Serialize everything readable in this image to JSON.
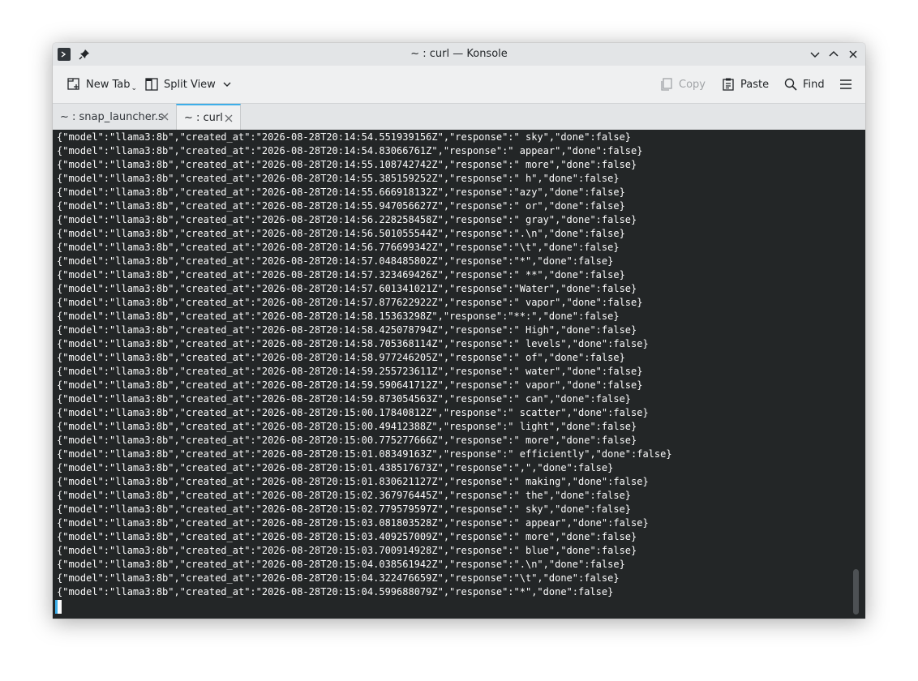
{
  "window": {
    "title": "~ : curl — Konsole"
  },
  "toolbar": {
    "new_tab_label": "New Tab",
    "split_view_label": "Split View",
    "copy_label": "Copy",
    "paste_label": "Paste",
    "find_label": "Find"
  },
  "tabs": [
    {
      "label": "~ : snap_launcher.s",
      "active": false
    },
    {
      "label": "~ : curl",
      "active": true
    }
  ],
  "colors": {
    "terminal_bg": "#232627",
    "terminal_fg": "#fcfcfc",
    "accent": "#3daee9"
  },
  "terminal": {
    "lines": [
      "{\"model\":\"llama3:8b\",\"created_at\":\"2026-08-28T20:14:54.551939156Z\",\"response\":\" sky\",\"done\":false}",
      "{\"model\":\"llama3:8b\",\"created_at\":\"2026-08-28T20:14:54.83066761Z\",\"response\":\" appear\",\"done\":false}",
      "{\"model\":\"llama3:8b\",\"created_at\":\"2026-08-28T20:14:55.108742742Z\",\"response\":\" more\",\"done\":false}",
      "{\"model\":\"llama3:8b\",\"created_at\":\"2026-08-28T20:14:55.385159252Z\",\"response\":\" h\",\"done\":false}",
      "{\"model\":\"llama3:8b\",\"created_at\":\"2026-08-28T20:14:55.666918132Z\",\"response\":\"azy\",\"done\":false}",
      "{\"model\":\"llama3:8b\",\"created_at\":\"2026-08-28T20:14:55.947056627Z\",\"response\":\" or\",\"done\":false}",
      "{\"model\":\"llama3:8b\",\"created_at\":\"2026-08-28T20:14:56.228258458Z\",\"response\":\" gray\",\"done\":false}",
      "{\"model\":\"llama3:8b\",\"created_at\":\"2026-08-28T20:14:56.501055544Z\",\"response\":\".\\n\",\"done\":false}",
      "{\"model\":\"llama3:8b\",\"created_at\":\"2026-08-28T20:14:56.776699342Z\",\"response\":\"\\t\",\"done\":false}",
      "{\"model\":\"llama3:8b\",\"created_at\":\"2026-08-28T20:14:57.048485802Z\",\"response\":\"*\",\"done\":false}",
      "{\"model\":\"llama3:8b\",\"created_at\":\"2026-08-28T20:14:57.323469426Z\",\"response\":\" **\",\"done\":false}",
      "{\"model\":\"llama3:8b\",\"created_at\":\"2026-08-28T20:14:57.601341021Z\",\"response\":\"Water\",\"done\":false}",
      "{\"model\":\"llama3:8b\",\"created_at\":\"2026-08-28T20:14:57.877622922Z\",\"response\":\" vapor\",\"done\":false}",
      "{\"model\":\"llama3:8b\",\"created_at\":\"2026-08-28T20:14:58.15363298Z\",\"response\":\"**:\",\"done\":false}",
      "{\"model\":\"llama3:8b\",\"created_at\":\"2026-08-28T20:14:58.425078794Z\",\"response\":\" High\",\"done\":false}",
      "{\"model\":\"llama3:8b\",\"created_at\":\"2026-08-28T20:14:58.705368114Z\",\"response\":\" levels\",\"done\":false}",
      "{\"model\":\"llama3:8b\",\"created_at\":\"2026-08-28T20:14:58.977246205Z\",\"response\":\" of\",\"done\":false}",
      "{\"model\":\"llama3:8b\",\"created_at\":\"2026-08-28T20:14:59.255723611Z\",\"response\":\" water\",\"done\":false}",
      "{\"model\":\"llama3:8b\",\"created_at\":\"2026-08-28T20:14:59.590641712Z\",\"response\":\" vapor\",\"done\":false}",
      "{\"model\":\"llama3:8b\",\"created_at\":\"2026-08-28T20:14:59.873054563Z\",\"response\":\" can\",\"done\":false}",
      "{\"model\":\"llama3:8b\",\"created_at\":\"2026-08-28T20:15:00.17840812Z\",\"response\":\" scatter\",\"done\":false}",
      "{\"model\":\"llama3:8b\",\"created_at\":\"2026-08-28T20:15:00.49412388Z\",\"response\":\" light\",\"done\":false}",
      "{\"model\":\"llama3:8b\",\"created_at\":\"2026-08-28T20:15:00.775277666Z\",\"response\":\" more\",\"done\":false}",
      "{\"model\":\"llama3:8b\",\"created_at\":\"2026-08-28T20:15:01.08349163Z\",\"response\":\" efficiently\",\"done\":false}",
      "{\"model\":\"llama3:8b\",\"created_at\":\"2026-08-28T20:15:01.438517673Z\",\"response\":\",\",\"done\":false}",
      "{\"model\":\"llama3:8b\",\"created_at\":\"2026-08-28T20:15:01.830621127Z\",\"response\":\" making\",\"done\":false}",
      "{\"model\":\"llama3:8b\",\"created_at\":\"2026-08-28T20:15:02.367976445Z\",\"response\":\" the\",\"done\":false}",
      "{\"model\":\"llama3:8b\",\"created_at\":\"2026-08-28T20:15:02.779579597Z\",\"response\":\" sky\",\"done\":false}",
      "{\"model\":\"llama3:8b\",\"created_at\":\"2026-08-28T20:15:03.081803528Z\",\"response\":\" appear\",\"done\":false}",
      "{\"model\":\"llama3:8b\",\"created_at\":\"2026-08-28T20:15:03.409257009Z\",\"response\":\" more\",\"done\":false}",
      "{\"model\":\"llama3:8b\",\"created_at\":\"2026-08-28T20:15:03.700914928Z\",\"response\":\" blue\",\"done\":false}",
      "{\"model\":\"llama3:8b\",\"created_at\":\"2026-08-28T20:15:04.038561942Z\",\"response\":\".\\n\",\"done\":false}",
      "{\"model\":\"llama3:8b\",\"created_at\":\"2026-08-28T20:15:04.322476659Z\",\"response\":\"\\t\",\"done\":false}",
      "{\"model\":\"llama3:8b\",\"created_at\":\"2026-08-28T20:15:04.599688079Z\",\"response\":\"*\",\"done\":false}"
    ]
  }
}
